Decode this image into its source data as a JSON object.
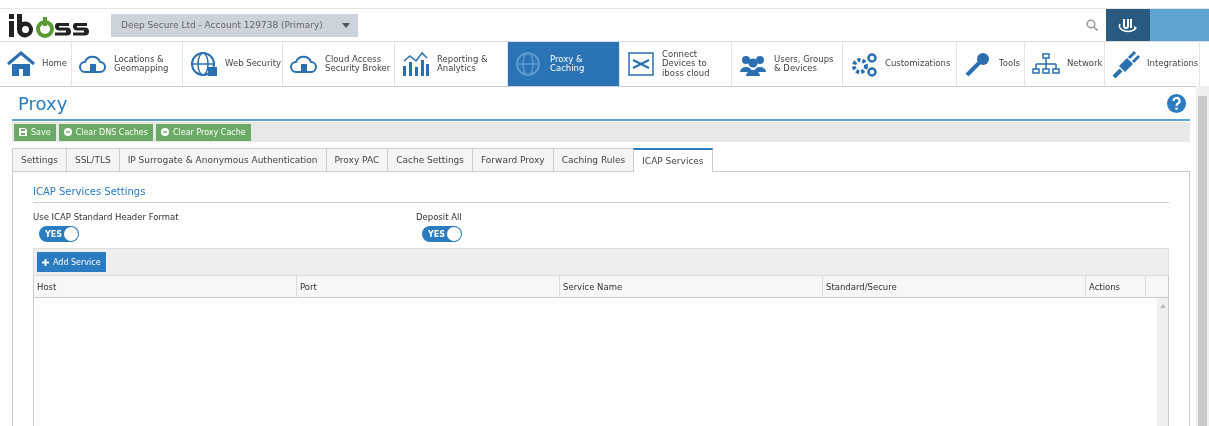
{
  "header": {
    "account_selector": {
      "value": "Deep Secure Ltd - Account 129738 (Primary)"
    }
  },
  "nav": [
    {
      "label": "Home",
      "selected": false
    },
    {
      "label": "Locations &\nGeomapping",
      "selected": false
    },
    {
      "label": "Web Security",
      "selected": false
    },
    {
      "label": "Cloud Access\nSecurity Broker",
      "selected": false
    },
    {
      "label": "Reporting &\nAnalytics",
      "selected": false
    },
    {
      "label": "Proxy &\nCaching",
      "selected": true
    },
    {
      "label": "Connect\nDevices to\niboss cloud",
      "selected": false
    },
    {
      "label": "Users, Groups\n& Devices",
      "selected": false
    },
    {
      "label": "Customizations",
      "selected": false
    },
    {
      "label": "Tools",
      "selected": false
    },
    {
      "label": "Network",
      "selected": false
    },
    {
      "label": "Integrations",
      "selected": false
    }
  ],
  "page": {
    "title": "Proxy"
  },
  "toolbar": [
    "Save",
    "Clear DNS Caches",
    "Clear Proxy Cache"
  ],
  "tabs": [
    {
      "label": "Settings",
      "selected": false
    },
    {
      "label": "SSL/TLS",
      "selected": false
    },
    {
      "label": "IP Surrogate & Anonymous Authentication",
      "selected": false
    },
    {
      "label": "Proxy PAC",
      "selected": false
    },
    {
      "label": "Cache Settings",
      "selected": false
    },
    {
      "label": "Forward Proxy",
      "selected": false
    },
    {
      "label": "Caching Rules",
      "selected": false
    },
    {
      "label": "ICAP Services",
      "selected": true
    }
  ],
  "section": {
    "title": "ICAP Services Settings",
    "toggles": [
      {
        "label": "Use ICAP Standard Header Format",
        "text": "YES",
        "on": true
      },
      {
        "label": "Deposit All",
        "text": "YES",
        "on": true
      }
    ]
  },
  "table": {
    "add_button": "Add Service",
    "columns": [
      "Host",
      "Port",
      "Service Name",
      "Standard/Secure",
      "Actions"
    ]
  }
}
